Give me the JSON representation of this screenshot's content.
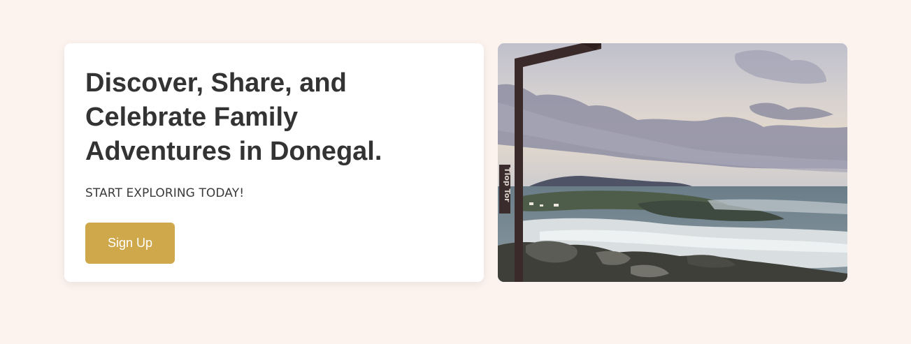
{
  "hero": {
    "headline": "Discover, Share, and Celebrate Family Adventures in Donegal.",
    "subheading": "START EXPLORING TODAY!",
    "cta_label": "Sign Up",
    "photo_sign_text": "Tlop Tor"
  },
  "colors": {
    "page_background": "#fcf2ee",
    "card_background": "#ffffff",
    "accent": "#cea84a",
    "heading_text": "#333333"
  }
}
